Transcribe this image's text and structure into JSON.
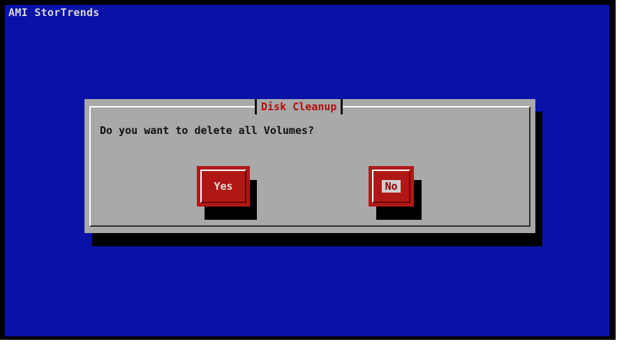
{
  "app": {
    "title": "AMI StorTrends"
  },
  "dialog": {
    "title": "Disk Cleanup",
    "message": "Do you want to delete all Volumes?",
    "buttons": {
      "yes_label": "Yes",
      "no_label": "No",
      "focused": "No"
    }
  },
  "colors": {
    "background": "#0a11a8",
    "dialog": "#a9a9a9",
    "button": "#b01818",
    "title_text": "#b01010"
  }
}
